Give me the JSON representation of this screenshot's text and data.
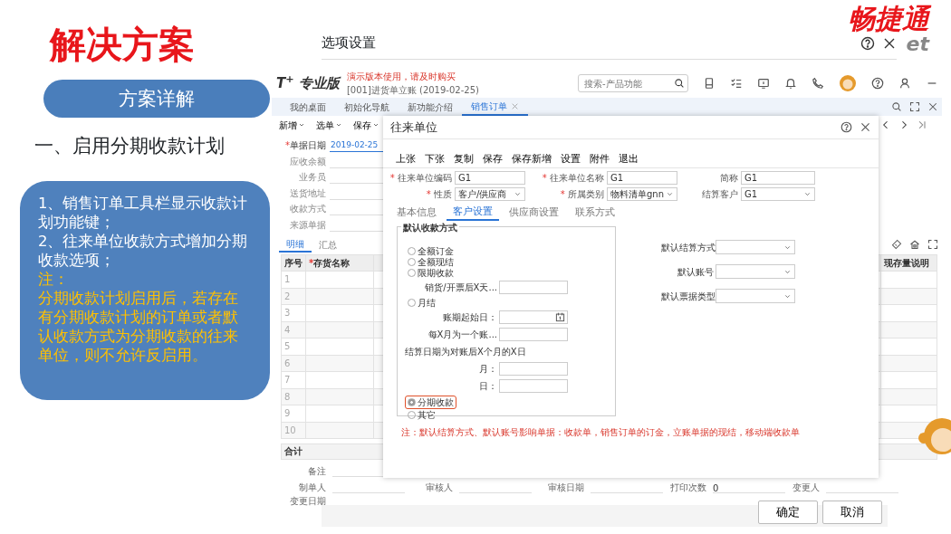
{
  "slide": {
    "title": "解决方案",
    "pill": "方案详解",
    "heading": "一、启用分期收款计划",
    "notes": [
      {
        "kind": "point",
        "text": "1、销售订单工具栏显示收款计划功能键；"
      },
      {
        "kind": "point",
        "text": "2、往来单位收款方式增加分期收款选项；"
      },
      {
        "kind": "caution",
        "text": "注："
      },
      {
        "kind": "caution",
        "text": "分期收款计划启用后，若存在有分期收款计划的订单或者默认收款方式为分期收款的往来单位，则不允许反启用。"
      }
    ]
  },
  "logo": {
    "name": "畅捷通",
    "suffix": "et"
  },
  "options_window": {
    "title": "选项设置",
    "buttons": [
      "确定",
      "取消"
    ]
  },
  "app": {
    "product": "T$^{+}$ 专业版",
    "notice": "演示版本使用，请及时购买",
    "account": "[001]进货单立账  (2019-02-25)",
    "search": {
      "placeholder": "搜索-产品功能"
    },
    "tabs": [
      {
        "label": "我的桌面",
        "selected": false,
        "closable": false
      },
      {
        "label": "初始化导航",
        "selected": false,
        "closable": false
      },
      {
        "label": "新功能介绍",
        "selected": false,
        "closable": false
      },
      {
        "label": "销售订单",
        "selected": true,
        "closable": true
      }
    ],
    "toolbar": [
      "新增",
      "选单",
      "保存"
    ],
    "form": [
      {
        "label": "单据日期",
        "mark": "*",
        "value": "2019-02-25"
      },
      {
        "label": "应收余额"
      },
      {
        "label": "业务员"
      },
      {
        "label": "送货地址"
      },
      {
        "label": "收款方式"
      },
      {
        "label": "来源单据"
      }
    ],
    "detail_tabs": [
      {
        "label": "明细",
        "selected": true
      },
      {
        "label": "汇总",
        "selected": false
      }
    ],
    "grid": {
      "columns": [
        {
          "label": "序号"
        },
        {
          "label": "存货名称",
          "mark": "*"
        }
      ],
      "last_column": "现存量说明",
      "rows": [
        "1",
        "2",
        "3",
        "4",
        "5",
        "6",
        "7",
        "8",
        "9",
        "10"
      ],
      "total": "合计"
    },
    "remark": "备注",
    "footer": [
      {
        "label": "制单人"
      },
      {
        "label": "审核人"
      },
      {
        "label": "审核日期"
      },
      {
        "label": "打印次数",
        "value": "0"
      },
      {
        "label": "变更人"
      }
    ],
    "changed_date": "变更日期"
  },
  "dialog": {
    "title": "往来单位",
    "toolbar": [
      "上张",
      "下张",
      "复制",
      "保存",
      "保存新增",
      "设置",
      "附件",
      "退出"
    ],
    "fields": [
      {
        "label": "往来单位编码",
        "mark": "*",
        "kind": "text",
        "value": "G1"
      },
      {
        "label": "往来单位名称",
        "mark": "*",
        "kind": "text",
        "value": "G1"
      },
      {
        "label": "简称",
        "kind": "text",
        "value": "G1"
      },
      {
        "label": "性质",
        "mark": "*",
        "kind": "select",
        "value": "客户/供应商"
      },
      {
        "label": "所属类别",
        "mark": "*",
        "kind": "select",
        "value": "物料清单gnn"
      },
      {
        "label": "结算客户",
        "kind": "select",
        "value": "G1"
      }
    ],
    "tabs": [
      {
        "label": "基本信息",
        "selected": false
      },
      {
        "label": "客户设置",
        "selected": true
      },
      {
        "label": "供应商设置",
        "selected": false
      },
      {
        "label": "联系方式",
        "selected": false
      }
    ],
    "payment": {
      "legend": "默认收款方式",
      "items": [
        {
          "kind": "radio",
          "label": "全额订金",
          "selected": false,
          "highlighted": false
        },
        {
          "kind": "radio",
          "label": "全额现结",
          "selected": false,
          "highlighted": false
        },
        {
          "kind": "radio",
          "label": "限期收款",
          "selected": false,
          "highlighted": false
        },
        {
          "kind": "field",
          "label": "销货/开票后X天..."
        },
        {
          "kind": "radio",
          "label": "月结",
          "selected": false,
          "highlighted": false
        },
        {
          "kind": "date_field",
          "label": "账期起始日："
        },
        {
          "kind": "field",
          "label": "每X月为一个账..."
        },
        {
          "kind": "caption",
          "label": "结算日期为对账后X个月的X日"
        },
        {
          "kind": "field",
          "label": "月："
        },
        {
          "kind": "field",
          "label": "日："
        },
        {
          "kind": "radio",
          "label": "分期收款",
          "selected": true,
          "highlighted": true
        },
        {
          "kind": "radio",
          "label": "其它",
          "selected": false,
          "highlighted": false
        }
      ]
    },
    "defaults": [
      {
        "label": "默认结算方式"
      },
      {
        "label": "默认账号"
      },
      {
        "label": "默认票据类型"
      }
    ],
    "note": "注：默认结算方式、默认账号影响单据：收款单，销售订单的订金，立账单据的现结，移动端收款单"
  }
}
